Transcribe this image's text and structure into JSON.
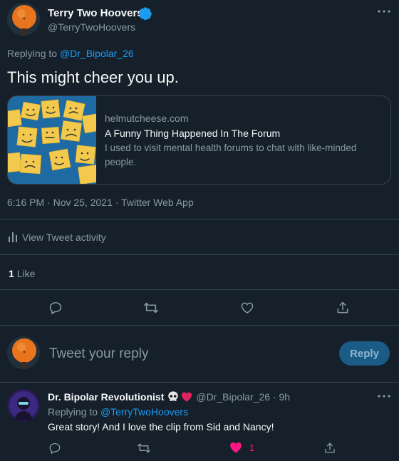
{
  "main_tweet": {
    "author_name": "Terry Two Hoovers",
    "author_handle": "@TerryTwoHoovers",
    "replying_prefix": "Replying to",
    "replying_to": "@Dr_Bipolar_26",
    "text": "This might cheer you up.",
    "card": {
      "domain": "helmutcheese.com",
      "title": "A Funny Thing Happened In The Forum",
      "description_line1": "I used to visit mental health forums to chat with like-minded",
      "description_line2": "people."
    },
    "meta": "6:16 PM · Nov 25, 2021 · Twitter Web App",
    "activity_label": "View Tweet activity",
    "likes_count": "1",
    "likes_label": "Like"
  },
  "composer": {
    "placeholder": "Tweet your reply",
    "button_label": "Reply"
  },
  "reply_tweet": {
    "author_name": "Dr. Bipolar Revolutionist",
    "author_handle_time": "@Dr_Bipolar_26 · 9h",
    "replying_prefix": "Replying to",
    "replying_to": "@TerryTwoHoovers",
    "text": "Great story! And I love the clip from Sid and Nancy!",
    "like_count": "1"
  },
  "colors": {
    "background": "#15202b",
    "accent": "#1d9bf0",
    "like_pink": "#f91880",
    "verified": "#1d9bf0"
  },
  "icons": [
    "more-icon",
    "verified-icon",
    "card-image",
    "activity-icon",
    "reply-icon",
    "retweet-icon",
    "like-icon",
    "share-icon",
    "skull-icon",
    "heart-icon"
  ]
}
